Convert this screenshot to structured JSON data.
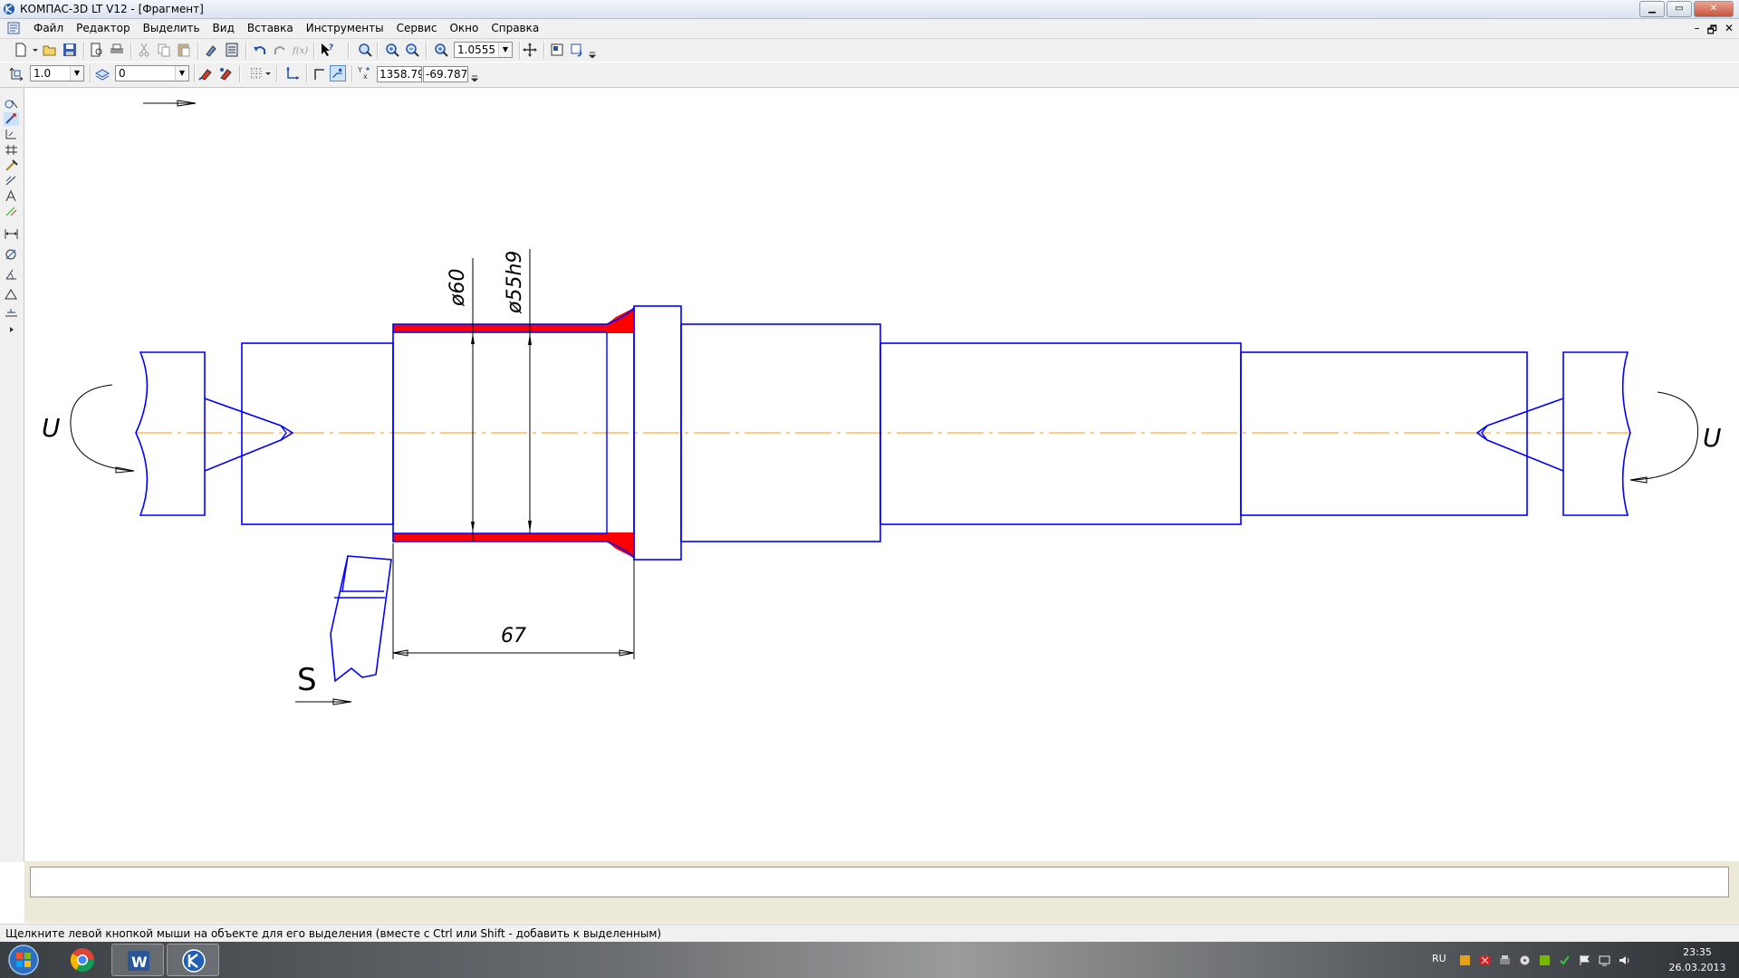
{
  "window": {
    "title": "КОМПАС-3D LT V12 - [Фрагмент]",
    "controls": [
      "minimize",
      "maximize",
      "close"
    ]
  },
  "menu": {
    "items": [
      "Файл",
      "Редактор",
      "Выделить",
      "Вид",
      "Вставка",
      "Инструменты",
      "Сервис",
      "Окно",
      "Справка"
    ],
    "mdi_controls": [
      "–",
      "🗗",
      "✕"
    ]
  },
  "toolbar_main": {
    "zoom_value": "1.0555",
    "icons": [
      "new-document-icon",
      "open-icon",
      "save-icon",
      "print-preview-icon",
      "print-icon",
      "cut-icon",
      "copy-icon",
      "paste-icon",
      "properties-icon",
      "calculator-icon",
      "undo-icon",
      "redo-icon",
      "function-icon",
      "help-cursor-icon",
      "zoom-window-icon",
      "zoom-in-icon",
      "zoom-out-icon",
      "zoom-scale-icon",
      "pan-icon",
      "refresh-icon",
      "redraw-icon"
    ]
  },
  "toolbar_current": {
    "scale_value": "1.0",
    "layer_value": "0",
    "coord_x": "1358.79",
    "coord_y": "-69.787"
  },
  "left_toolbar": {
    "icons": [
      "geometry-icon",
      "edit-icon",
      "selection-icon",
      "parametric-icon",
      "measure-icon",
      "dimensions-icon",
      "designations-icon",
      "tolerance-icon",
      "linear-dimension-icon",
      "diameter-dimension-icon",
      "angular-dimension-icon",
      "roughness-icon",
      "base-icon",
      "expand-icon"
    ]
  },
  "drawing": {
    "dim_diameter_60": "ø60",
    "dim_diameter_55h9": "ø55h9",
    "dim_length_67": "67",
    "label_u_left": "U",
    "label_u_right": "U",
    "label_s": "S",
    "colors": {
      "outline": "#0000ff",
      "cut_fill": "#ff0000",
      "axis": "#ff9900",
      "dimension": "#000000"
    }
  },
  "status": {
    "hint": "Щелкните левой кнопкой мыши на объекте для его выделения (вместе с Ctrl или Shift - добавить к выделенным)"
  },
  "taskbar": {
    "apps": [
      "start-button",
      "chrome-app",
      "word-app",
      "kompas-app"
    ],
    "language": "RU",
    "time": "23:35",
    "date": "26.03.2013"
  }
}
